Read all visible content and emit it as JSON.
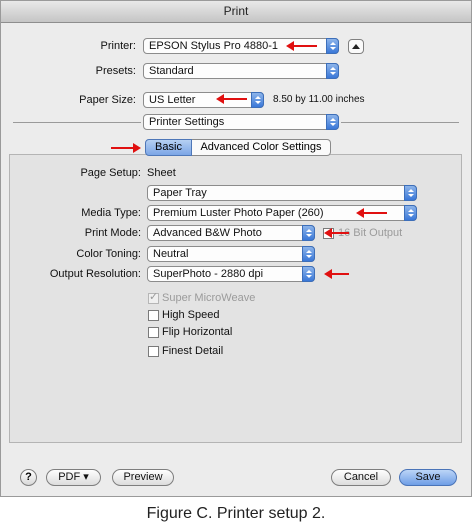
{
  "window": {
    "title": "Print"
  },
  "printer": {
    "label": "Printer:",
    "value": "EPSON Stylus Pro 4880-1"
  },
  "presets": {
    "label": "Presets:",
    "value": "Standard"
  },
  "paper_size": {
    "label": "Paper Size:",
    "value": "US Letter",
    "dimensions": "8.50 by 11.00 inches"
  },
  "section_popup": {
    "value": "Printer Settings"
  },
  "tabs": [
    {
      "label": "Basic",
      "selected": true
    },
    {
      "label": "Advanced Color Settings",
      "selected": false
    }
  ],
  "page_setup": {
    "label": "Page Setup:",
    "value": "Sheet"
  },
  "source": {
    "value": "Paper Tray"
  },
  "media_type": {
    "label": "Media Type:",
    "value": "Premium Luster Photo Paper (260)"
  },
  "print_mode": {
    "label": "Print Mode:",
    "value": "Advanced B&W Photo",
    "option_label": "16 Bit Output"
  },
  "color_toning": {
    "label": "Color Toning:",
    "value": "Neutral"
  },
  "output_resolution": {
    "label": "Output Resolution:",
    "value": "SuperPhoto - 2880 dpi"
  },
  "checkboxes": [
    {
      "label": "Super MicroWeave",
      "checked": true,
      "disabled": true
    },
    {
      "label": "High Speed",
      "checked": false,
      "disabled": false
    },
    {
      "label": "Flip Horizontal",
      "checked": false,
      "disabled": false
    },
    {
      "label": "Finest Detail",
      "checked": false,
      "disabled": false
    }
  ],
  "footer": {
    "help": "?",
    "pdf": "PDF ▾",
    "preview": "Preview",
    "cancel": "Cancel",
    "save": "Save"
  },
  "caption": "Figure C. Printer setup 2.",
  "colors": {
    "accent": "#3a78d8",
    "annotation_arrow": "#e01010",
    "dialog_bg": "#ececec"
  }
}
